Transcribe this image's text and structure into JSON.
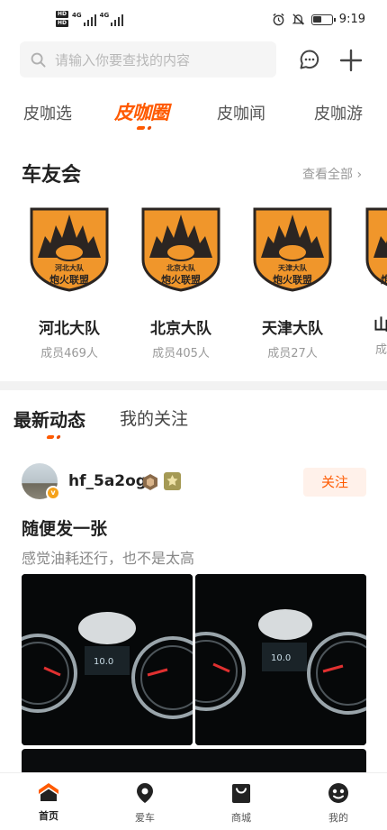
{
  "status_bar": {
    "hd1": "HD",
    "hd2": "HD",
    "sig1": "4G",
    "sig2": "4G",
    "time": "9:19"
  },
  "search": {
    "placeholder": "请输入你要查找的内容"
  },
  "channels": [
    {
      "label": "皮咖选",
      "active": false
    },
    {
      "label": "皮咖圈",
      "active": true
    },
    {
      "label": "皮咖闻",
      "active": false
    },
    {
      "label": "皮咖游",
      "active": false
    }
  ],
  "club_section": {
    "title": "车友会",
    "see_all": "查看全部 ›",
    "clubs": [
      {
        "name": "河北大队",
        "members": "成员469人",
        "logo_text_top": "河北大队",
        "logo_text_bottom": "炮火联盟"
      },
      {
        "name": "北京大队",
        "members": "成员405人",
        "logo_text_top": "北京大队",
        "logo_text_bottom": "炮火联盟"
      },
      {
        "name": "天津大队",
        "members": "成员27人",
        "logo_text_top": "天津大队",
        "logo_text_bottom": "炮火联盟"
      },
      {
        "name": "山",
        "members": "成",
        "logo_text_top": "",
        "logo_text_bottom": "炮"
      }
    ]
  },
  "feed_tabs": [
    {
      "label": "最新动态",
      "active": true
    },
    {
      "label": "我的关注",
      "active": false
    }
  ],
  "post": {
    "username": "hf_5a2og",
    "verified_badge": "v",
    "follow_label": "关注",
    "title": "随便发一张",
    "body": "感觉油耗还行，也不是太高",
    "photo_readout": "10.0"
  },
  "bottom_nav": [
    {
      "label": "首页",
      "icon": "home-icon",
      "active": true
    },
    {
      "label": "爱车",
      "icon": "location-pin-icon",
      "active": false
    },
    {
      "label": "商城",
      "icon": "shopping-bag-icon",
      "active": false
    },
    {
      "label": "我的",
      "icon": "user-face-icon",
      "active": false
    }
  ],
  "colors": {
    "accent": "#ff5a00",
    "badge_orange": "#f5a21b",
    "logo_orange": "#f0962b",
    "logo_dark": "#2b2522"
  }
}
